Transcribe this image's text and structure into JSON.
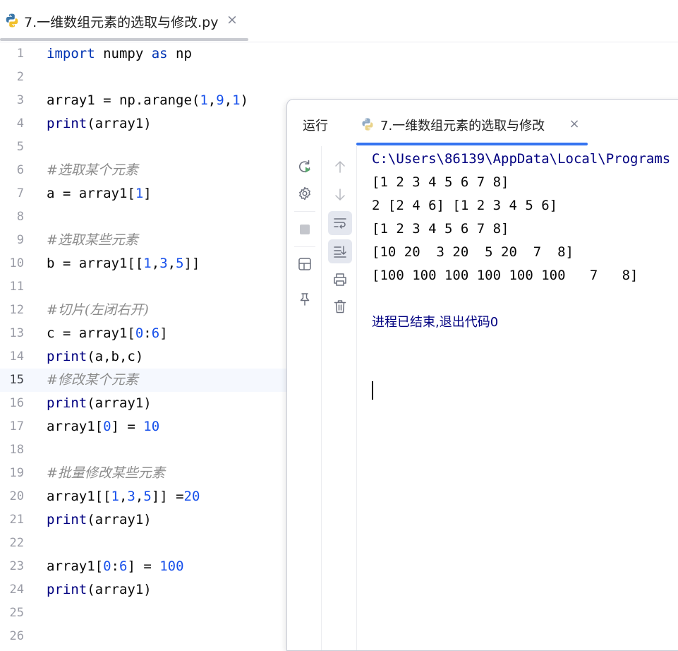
{
  "editor_tab": {
    "title": "7.一维数组元素的选取与修改.py",
    "close": "×"
  },
  "editor": {
    "current_line": 15,
    "lines": [
      {
        "n": "1",
        "tokens": [
          [
            "kw",
            "import"
          ],
          [
            "p",
            " numpy "
          ],
          [
            "kw",
            "as"
          ],
          [
            "p",
            " np"
          ]
        ]
      },
      {
        "n": "2",
        "tokens": []
      },
      {
        "n": "3",
        "tokens": [
          [
            "p",
            "array1 = np.arange("
          ],
          [
            "num",
            "1"
          ],
          [
            "p",
            ","
          ],
          [
            "num",
            "9"
          ],
          [
            "p",
            ","
          ],
          [
            "num",
            "1"
          ],
          [
            "p",
            ")"
          ]
        ]
      },
      {
        "n": "4",
        "tokens": [
          [
            "fn",
            "print"
          ],
          [
            "p",
            "(array1)"
          ]
        ]
      },
      {
        "n": "5",
        "tokens": []
      },
      {
        "n": "6",
        "tokens": [
          [
            "cm",
            "#选取某个元素"
          ]
        ]
      },
      {
        "n": "7",
        "tokens": [
          [
            "p",
            "a = array1["
          ],
          [
            "num",
            "1"
          ],
          [
            "p",
            "]"
          ]
        ]
      },
      {
        "n": "8",
        "tokens": []
      },
      {
        "n": "9",
        "tokens": [
          [
            "cm",
            "#选取某些元素"
          ]
        ]
      },
      {
        "n": "10",
        "tokens": [
          [
            "p",
            "b = array1[["
          ],
          [
            "num",
            "1"
          ],
          [
            "p",
            ","
          ],
          [
            "num",
            "3"
          ],
          [
            "p",
            ","
          ],
          [
            "num",
            "5"
          ],
          [
            "p",
            "]]"
          ]
        ]
      },
      {
        "n": "11",
        "tokens": []
      },
      {
        "n": "12",
        "tokens": [
          [
            "cm",
            "#切片(左闭右开)"
          ]
        ]
      },
      {
        "n": "13",
        "tokens": [
          [
            "p",
            "c = array1["
          ],
          [
            "num",
            "0"
          ],
          [
            "p",
            ":"
          ],
          [
            "num",
            "6"
          ],
          [
            "p",
            "]"
          ]
        ]
      },
      {
        "n": "14",
        "tokens": [
          [
            "fn",
            "print"
          ],
          [
            "p",
            "(a,b,c)"
          ]
        ]
      },
      {
        "n": "15",
        "tokens": [
          [
            "cm",
            "#修改某个元素"
          ]
        ]
      },
      {
        "n": "16",
        "tokens": [
          [
            "fn",
            "print"
          ],
          [
            "p",
            "(array1)"
          ]
        ]
      },
      {
        "n": "17",
        "tokens": [
          [
            "p",
            "array1["
          ],
          [
            "num",
            "0"
          ],
          [
            "p",
            "] = "
          ],
          [
            "num",
            "10"
          ]
        ]
      },
      {
        "n": "18",
        "tokens": []
      },
      {
        "n": "19",
        "tokens": [
          [
            "cm",
            "#批量修改某些元素"
          ]
        ]
      },
      {
        "n": "20",
        "tokens": [
          [
            "p",
            "array1[["
          ],
          [
            "num",
            "1"
          ],
          [
            "p",
            ","
          ],
          [
            "num",
            "3"
          ],
          [
            "p",
            ","
          ],
          [
            "num",
            "5"
          ],
          [
            "p",
            "]] ="
          ],
          [
            "num",
            "20"
          ]
        ]
      },
      {
        "n": "21",
        "tokens": [
          [
            "fn",
            "print"
          ],
          [
            "p",
            "(array1)"
          ]
        ]
      },
      {
        "n": "22",
        "tokens": []
      },
      {
        "n": "23",
        "tokens": [
          [
            "p",
            "array1["
          ],
          [
            "num",
            "0"
          ],
          [
            "p",
            ":"
          ],
          [
            "num",
            "6"
          ],
          [
            "p",
            "] = "
          ],
          [
            "num",
            "100"
          ]
        ]
      },
      {
        "n": "24",
        "tokens": [
          [
            "fn",
            "print"
          ],
          [
            "p",
            "(array1)"
          ]
        ]
      },
      {
        "n": "25",
        "tokens": []
      },
      {
        "n": "26",
        "tokens": []
      }
    ]
  },
  "run_window": {
    "label": "运行",
    "tab_title": "7.一维数组元素的选取与修改",
    "tab_close": "×",
    "accent": "#3574f0",
    "left_tools": [
      "rerun-icon",
      "settings-icon",
      "stop-icon",
      "layout-icon",
      "pin-icon"
    ],
    "right_tools": [
      "scroll-up-icon",
      "scroll-down-icon",
      "soft-wrap-icon",
      "scroll-to-end-icon",
      "print-icon",
      "trash-icon"
    ],
    "console": {
      "path": "C:\\Users\\86139\\AppData\\Local\\Programs",
      "output": [
        "[1 2 3 4 5 6 7 8]",
        "2 [2 4 6] [1 2 3 4 5 6]",
        "[1 2 3 4 5 6 7 8]",
        "[10 20  3 20  5 20  7  8]",
        "[100 100 100 100 100 100   7   8]"
      ],
      "exit_message": "进程已结束,退出代码0"
    }
  }
}
